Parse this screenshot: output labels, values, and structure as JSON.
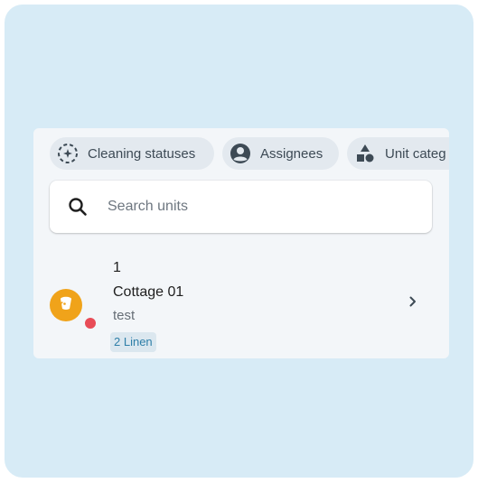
{
  "filters": {
    "chips": [
      {
        "label": "Cleaning statuses",
        "icon": "cleaning-status-icon"
      },
      {
        "label": "Assignees",
        "icon": "account-circle-icon"
      },
      {
        "label": "Unit categ",
        "icon": "category-shapes-icon"
      }
    ]
  },
  "search": {
    "placeholder": "Search units",
    "icon": "search-icon"
  },
  "units": [
    {
      "number": "1",
      "name": "Cottage 01",
      "description": "test",
      "tag": "2 Linen",
      "avatar_icon": "cleaning-bucket-icon",
      "status_color": "#e84c57",
      "avatar_color": "#f0a31a"
    }
  ],
  "colors": {
    "background": "#d7ebf6",
    "panel": "#f3f6f9",
    "chip": "#e3e9ef",
    "tag_text": "#2f7fa8"
  }
}
